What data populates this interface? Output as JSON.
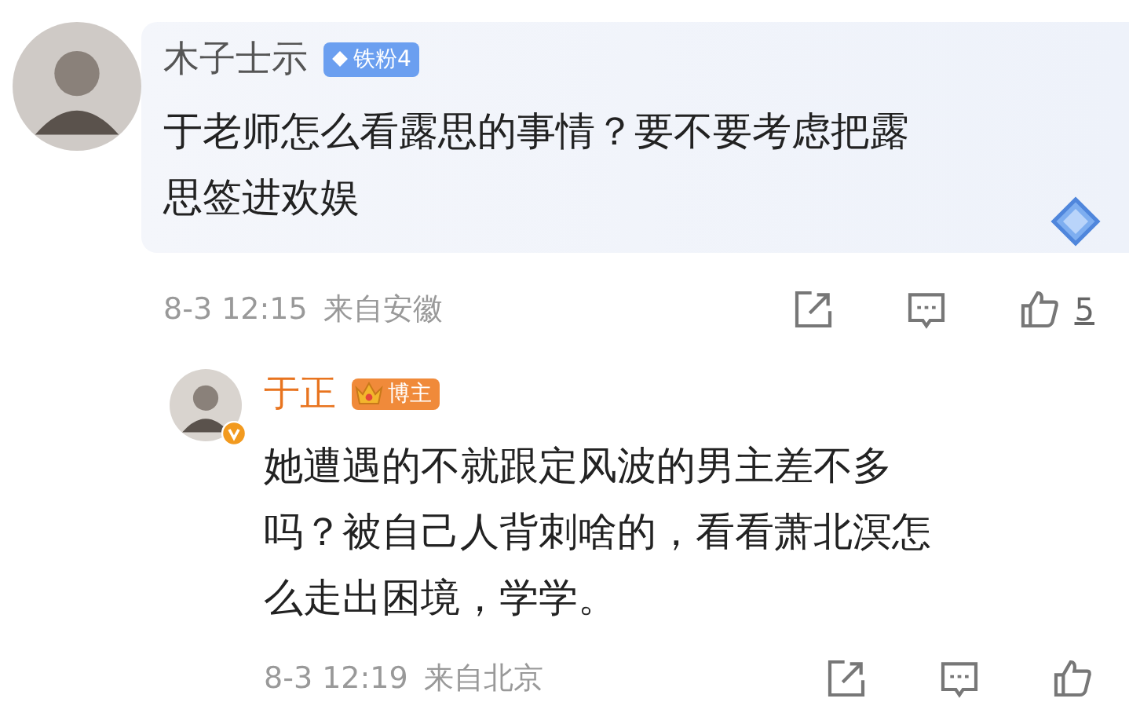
{
  "comments": [
    {
      "kind": "main",
      "name": "木子士示",
      "badge": {
        "kind": "fan",
        "label": "铁粉4"
      },
      "verified": false,
      "text_lines": [
        "于老师怎么看露思的事情？要不要考虑把露",
        "思签进欢娱"
      ],
      "time": "8-3 12:15",
      "location": "来自安徽",
      "likes": "5"
    },
    {
      "kind": "reply",
      "name": "于正",
      "badge": {
        "kind": "blogger",
        "label": "博主"
      },
      "verified": true,
      "text_lines": [
        "她遭遇的不就跟定风波的男主差不多",
        "吗？被自己人背刺啥的，看看萧北溟怎",
        "么走出困境，学学。"
      ],
      "time": "8-3 12:19",
      "location": "来自北京"
    }
  ]
}
